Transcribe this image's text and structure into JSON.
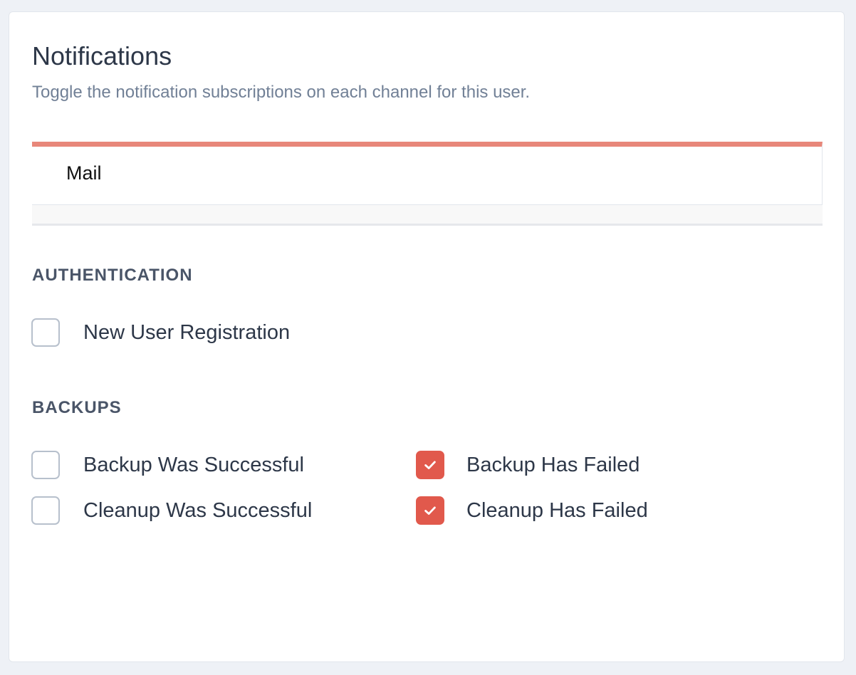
{
  "header": {
    "title": "Notifications",
    "subtitle": "Toggle the notification subscriptions on each channel for this user."
  },
  "tabs": [
    {
      "label": "Mail",
      "active": true
    }
  ],
  "colors": {
    "accent": "#e1594c",
    "tab_indicator": "#e8877a",
    "heading": "#4a5568",
    "muted": "#718096"
  },
  "sections": [
    {
      "heading": "AUTHENTICATION",
      "options": [
        {
          "label": "New User Registration",
          "checked": false
        }
      ]
    },
    {
      "heading": "BACKUPS",
      "options": [
        {
          "label": "Backup Was Successful",
          "checked": false
        },
        {
          "label": "Backup Has Failed",
          "checked": true
        },
        {
          "label": "Cleanup Was Successful",
          "checked": false
        },
        {
          "label": "Cleanup Has Failed",
          "checked": true
        }
      ]
    }
  ]
}
